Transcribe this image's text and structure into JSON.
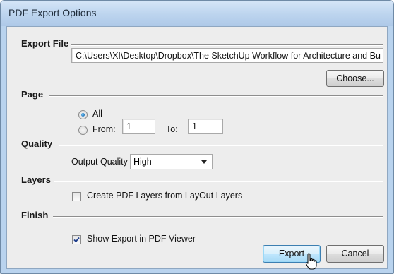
{
  "window": {
    "title": "PDF Export Options"
  },
  "export_file": {
    "label": "Export File",
    "path": "C:\\Users\\XI\\Desktop\\Dropbox\\The SketchUp Workflow for Architecture and Bu",
    "choose_label": "Choose..."
  },
  "page": {
    "label": "Page",
    "all_label": "All",
    "from_label": "From:",
    "from_value": "1",
    "to_label": "To:",
    "to_value": "1",
    "selected": "All"
  },
  "quality": {
    "label": "Quality",
    "output_label": "Output Quality",
    "output_value": "High"
  },
  "layers": {
    "label": "Layers",
    "create_layers_label": "Create PDF Layers from LayOut Layers",
    "create_layers_checked": false
  },
  "finish": {
    "label": "Finish",
    "show_export_label": "Show Export in PDF Viewer",
    "show_export_checked": true
  },
  "buttons": {
    "export_label": "Export",
    "cancel_label": "Cancel"
  }
}
